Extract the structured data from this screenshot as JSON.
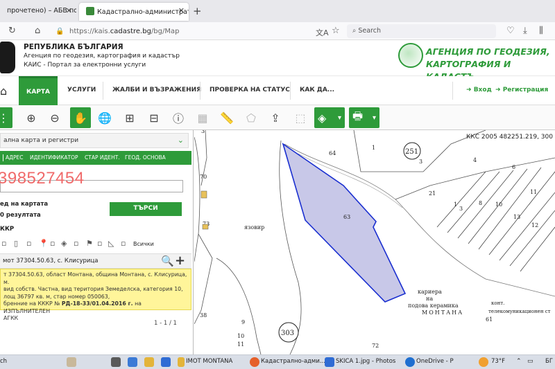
{
  "browser": {
    "tab1_title": "прочетено) – АБВ поща",
    "tab2_title": "Кадастрално-административн",
    "url_prefix": "https://kais.",
    "url_domain": "cadastre.bg",
    "url_path": "/bg/Map",
    "search_placeholder": "Search"
  },
  "site": {
    "republic": "РЕПУБЛИКА БЪЛГАРИЯ",
    "agency": "Агенция по геодезия, картография и кадастър",
    "portal": "КАИС - Портал за електронни услуги",
    "logo_line1": "АГЕНЦИЯ ПО ГЕОДЕЗИЯ,",
    "logo_line2": "КАРТОГРАФИЯ И КАДАСТЪ",
    "nav": [
      "КАРТА",
      "УСЛУГИ",
      "ЖАЛБИ И ВЪЗРАЖЕНИЯ",
      "ПРОВЕРКА НА СТАТУС",
      "КАК ДА..."
    ],
    "login": "Вход",
    "register": "Регистрация"
  },
  "panel": {
    "dropdown": "ална карта и регистри",
    "tabs": [
      "АДРЕС",
      "ИДЕНТИФИКАТОР",
      "СТАР ИДЕНТ.",
      "ГЕОД. ОСНОВА"
    ],
    "big_number": "398527454",
    "on_map": "ед на картата",
    "search_button": "ТЪРСИ",
    "results": "0 резултата",
    "kkr": "ККР",
    "all_label": "Всички",
    "result_title": "мот 37304.50.63, с. Клисурица",
    "result_info_lines": [
      "т 37304.50.63, област Монтана, община Монтана, с. Клисурица, м.",
      "вид собств. Частна, вид територия Земеделска, категория 10,",
      "лощ 36797 кв. м, стар номер 050063,",
      "бренние на КККР №"
    ],
    "result_info_bold": "РД-18-33/01.04.2016 г.",
    "result_info_tail": " на ИЗПЪЛНИТЕЛЕН",
    "result_info_last": "АГКК",
    "pager": "1 - 1 / 1"
  },
  "map": {
    "header": "ККС 2005 482251.219, 300",
    "reservoir": "язовир",
    "quarry_line1": "кариера",
    "quarry_line2": "на",
    "quarry_line3": "подова керамика",
    "quarry_line4": "МОНТАНА",
    "contour": "конт.",
    "telecom": "телекомуникационен ст",
    "parcel_selected": "63",
    "circle_a": "251",
    "circle_b": "303",
    "highlight_color": "#c8c8e8",
    "outline_color": "#1a2fd0"
  },
  "taskbar": {
    "search": "ch",
    "app1": "IMOT MONTANA",
    "app2": "Кадастрално-адми...",
    "app3": "SKICA 1.jpg - Photos",
    "app4": "OneDrive - Р",
    "weather": "73°F",
    "lang": "БГ"
  }
}
